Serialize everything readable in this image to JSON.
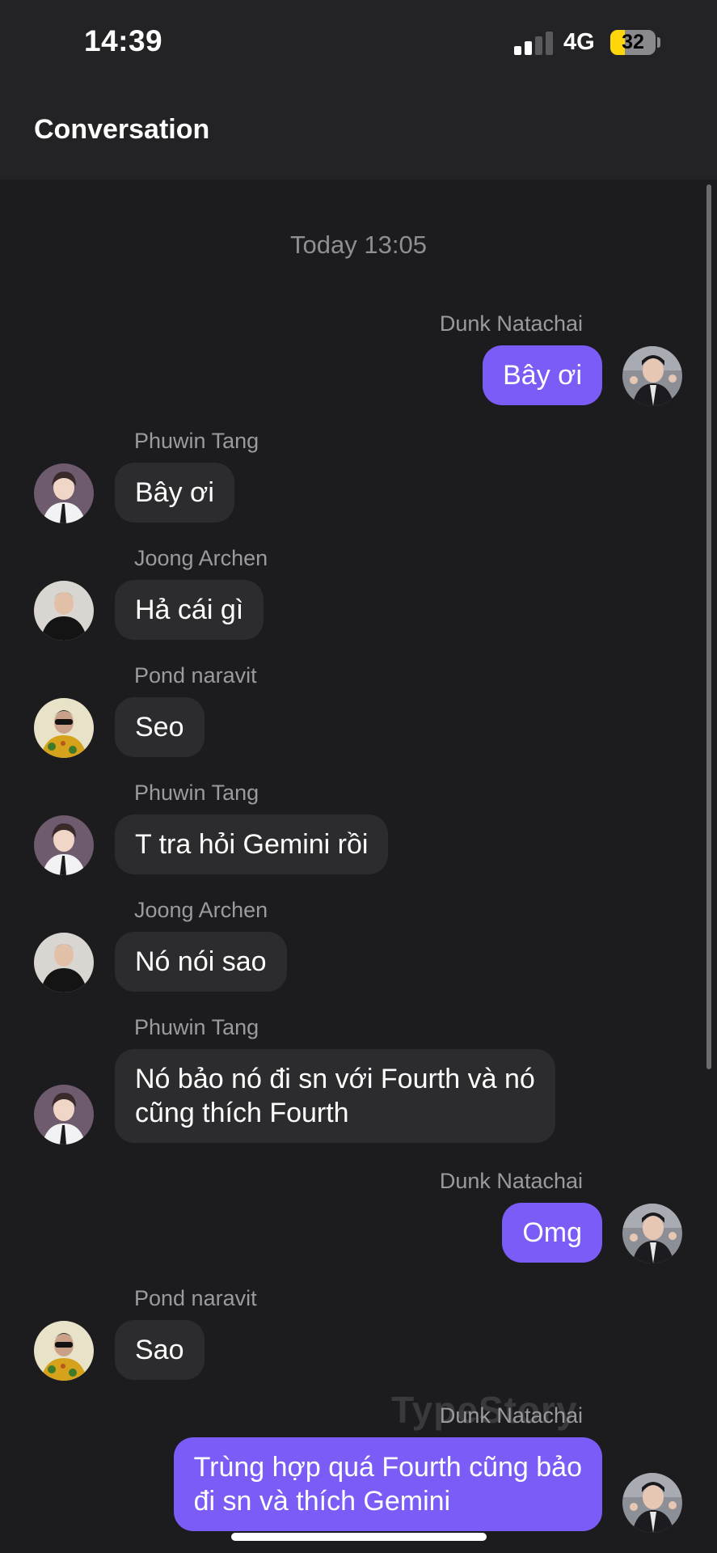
{
  "status_bar": {
    "time": "14:39",
    "network": "4G",
    "battery": "32",
    "battery_level": 0.32
  },
  "header": {
    "title": "Conversation"
  },
  "chat": {
    "timestamp": "Today 13:05",
    "messages": [
      {
        "sender": "Dunk Natachai",
        "text": "Bây ơi",
        "direction": "out",
        "avatar": "dunk-avatar"
      },
      {
        "sender": "Phuwin Tang",
        "text": "Bây ơi",
        "direction": "in",
        "avatar": "phuwin-avatar"
      },
      {
        "sender": "Joong Archen",
        "text": "Hả cái gì",
        "direction": "in",
        "avatar": "joong-avatar"
      },
      {
        "sender": "Pond naravit",
        "text": "Seo",
        "direction": "in",
        "avatar": "pond-avatar"
      },
      {
        "sender": "Phuwin Tang",
        "text": "T tra hỏi Gemini rồi",
        "direction": "in",
        "avatar": "phuwin-avatar"
      },
      {
        "sender": "Joong Archen",
        "text": "Nó nói sao",
        "direction": "in",
        "avatar": "joong-avatar"
      },
      {
        "sender": "Phuwin Tang",
        "text_lines": [
          "Nó bảo nó đi sn với Fourth và nó",
          "cũng thích Fourth"
        ],
        "direction": "in",
        "avatar": "phuwin-avatar"
      },
      {
        "sender": "Dunk Natachai",
        "text": "Omg",
        "direction": "out",
        "avatar": "dunk-avatar"
      },
      {
        "sender": "Pond naravit",
        "text": "Sao",
        "direction": "in",
        "avatar": "pond-avatar"
      },
      {
        "sender": "Dunk Natachai",
        "text_lines": [
          "Trùng hợp quá Fourth cũng bảo",
          "đi sn và thích Gemini"
        ],
        "direction": "out",
        "avatar": "dunk-avatar"
      }
    ]
  },
  "watermark": "TypeStory",
  "colors": {
    "outgoing_bubble": "#7b5cf6",
    "incoming_bubble": "#2c2c2e",
    "background": "#1c1c1e",
    "battery_fill": "#ffd60a"
  }
}
